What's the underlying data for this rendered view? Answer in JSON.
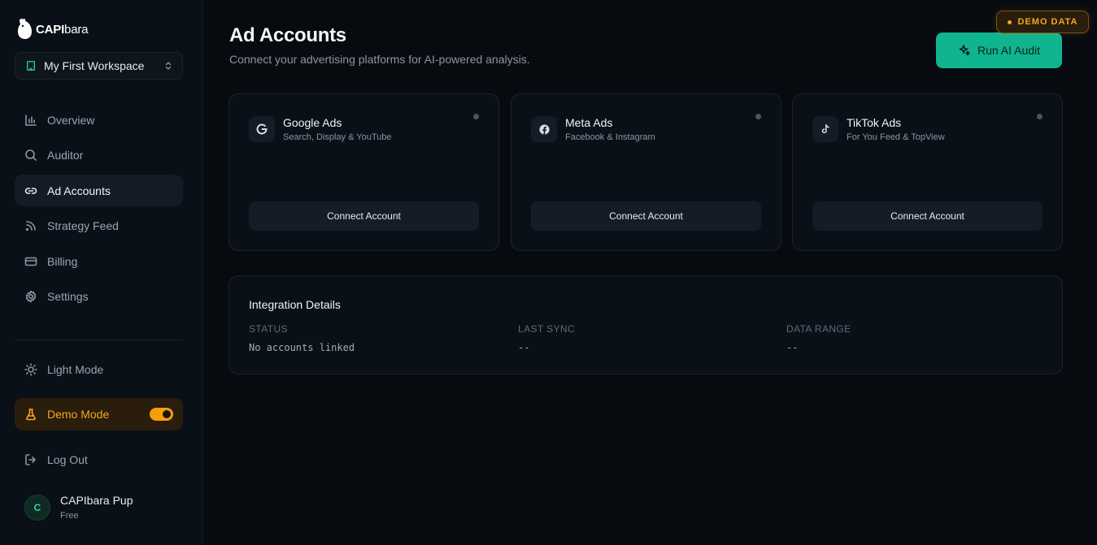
{
  "app": {
    "logo_bold": "CAPI",
    "logo_light": "bara"
  },
  "workspace": {
    "name": "My First Workspace"
  },
  "nav": {
    "items": [
      {
        "label": "Overview",
        "icon": "bar-chart-icon",
        "active": false
      },
      {
        "label": "Auditor",
        "icon": "search-icon",
        "active": false
      },
      {
        "label": "Ad Accounts",
        "icon": "link-icon",
        "active": true
      },
      {
        "label": "Strategy Feed",
        "icon": "rss-icon",
        "active": false
      },
      {
        "label": "Billing",
        "icon": "credit-card-icon",
        "active": false
      },
      {
        "label": "Settings",
        "icon": "gear-icon",
        "active": false
      }
    ]
  },
  "sidebar_bottom": {
    "light_mode": "Light Mode",
    "demo_mode": "Demo Mode",
    "demo_mode_on": true,
    "log_out": "Log Out"
  },
  "user": {
    "initial": "C",
    "name": "CAPIbara Pup",
    "plan": "Free"
  },
  "header": {
    "title": "Ad Accounts",
    "subtitle": "Connect your advertising platforms for AI-powered analysis.",
    "demo_badge": "DEMO DATA",
    "run_audit": "Run AI Audit"
  },
  "platforms": [
    {
      "name": "Google Ads",
      "desc": "Search, Display & YouTube",
      "icon": "google-icon",
      "button": "Connect Account"
    },
    {
      "name": "Meta Ads",
      "desc": "Facebook & Instagram",
      "icon": "facebook-icon",
      "button": "Connect Account"
    },
    {
      "name": "TikTok Ads",
      "desc": "For You Feed & TopView",
      "icon": "tiktok-icon",
      "button": "Connect Account"
    }
  ],
  "integration": {
    "title": "Integration Details",
    "columns": [
      {
        "label": "STATUS",
        "value": "No accounts linked"
      },
      {
        "label": "LAST SYNC",
        "value": "--"
      },
      {
        "label": "DATA RANGE",
        "value": "--"
      }
    ]
  },
  "colors": {
    "accent": "#10b48e",
    "demo": "#f5a623",
    "background": "#070b10"
  }
}
